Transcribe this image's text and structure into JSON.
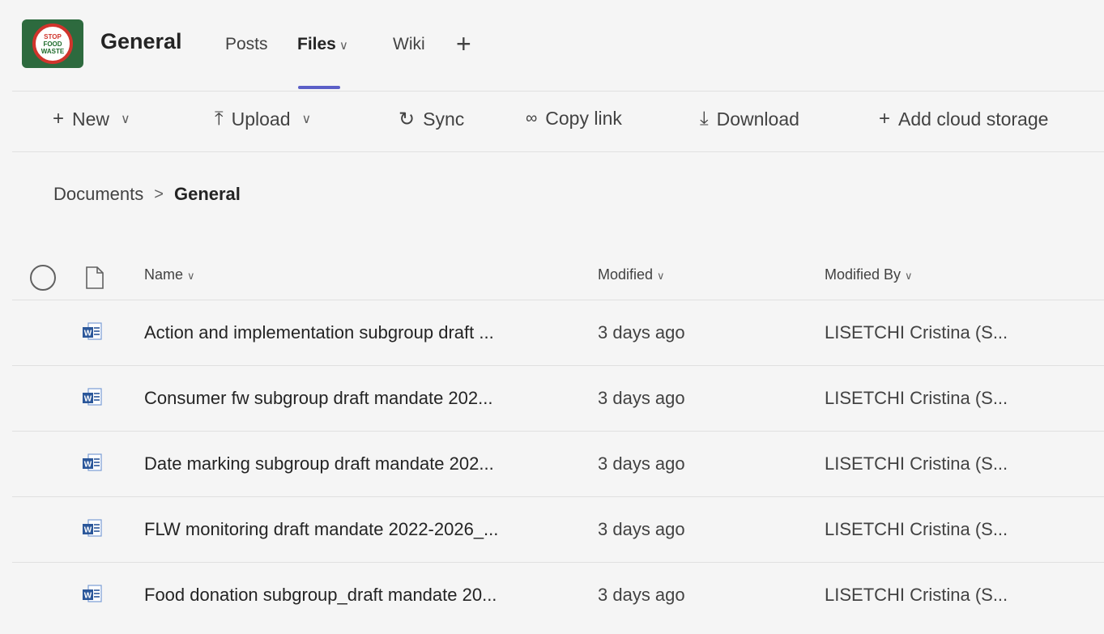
{
  "header": {
    "logo_lines": [
      "STOP",
      "FOOD",
      "WASTE"
    ],
    "team_name": "General",
    "tabs": [
      {
        "label": "Posts"
      },
      {
        "label": "Files",
        "active": true
      },
      {
        "label": "Wiki"
      }
    ],
    "add_tab_glyph": "+",
    "accent_color": "#5b5fc7"
  },
  "toolbar": {
    "new_label": "New",
    "upload_label": "Upload",
    "sync_label": "Sync",
    "copy_link_label": "Copy link",
    "download_label": "Download",
    "add_cloud_label": "Add cloud storage"
  },
  "breadcrumb": {
    "root": "Documents",
    "current": "General"
  },
  "columns": {
    "name": "Name",
    "modified": "Modified",
    "modified_by": "Modified By"
  },
  "files": [
    {
      "name": "Action and implementation subgroup draft ...",
      "modified": "3 days ago",
      "modified_by": "LISETCHI Cristina (S..."
    },
    {
      "name": "Consumer fw subgroup draft mandate 202...",
      "modified": "3 days ago",
      "modified_by": "LISETCHI Cristina (S..."
    },
    {
      "name": "Date marking subgroup draft mandate 202...",
      "modified": "3 days ago",
      "modified_by": "LISETCHI Cristina (S..."
    },
    {
      "name": "FLW monitoring draft mandate 2022-2026_...",
      "modified": "3 days ago",
      "modified_by": "LISETCHI Cristina (S..."
    },
    {
      "name": "Food donation subgroup_draft mandate 20...",
      "modified": "3 days ago",
      "modified_by": "LISETCHI Cristina (S..."
    }
  ]
}
